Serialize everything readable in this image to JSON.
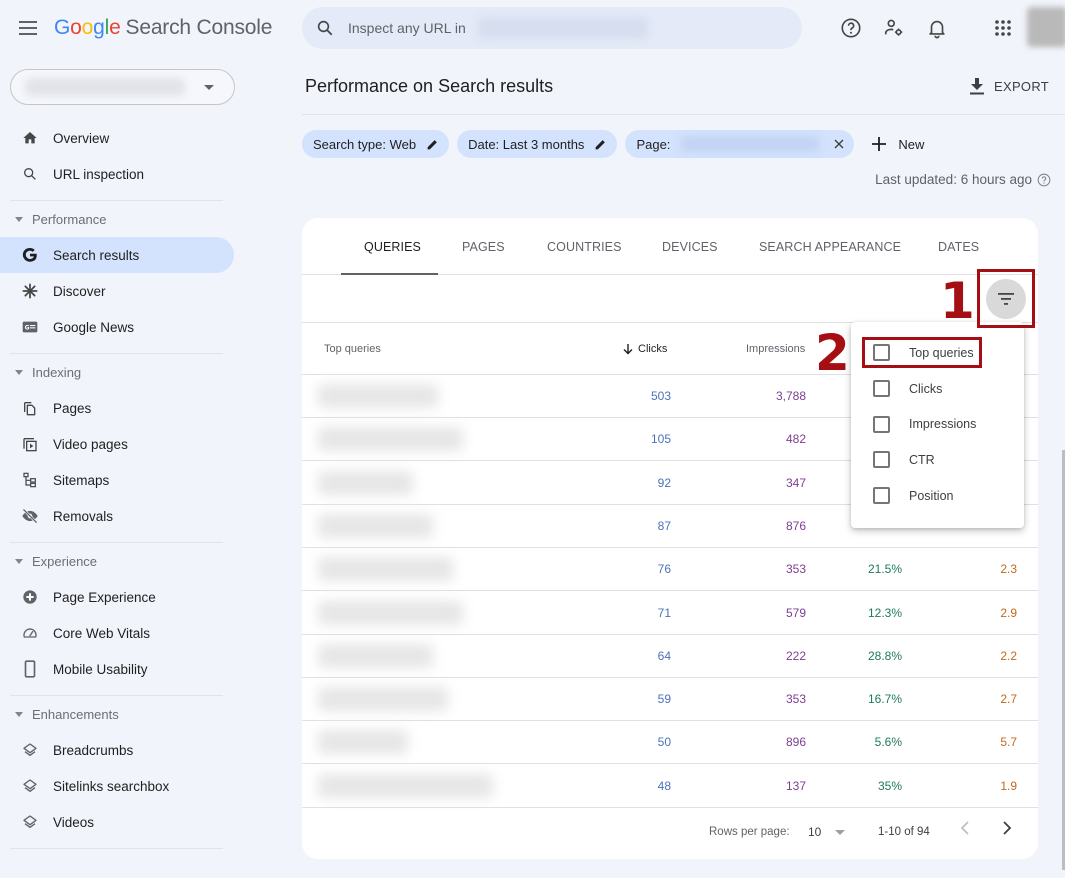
{
  "app": {
    "logo_google": [
      "G",
      "o",
      "o",
      "g",
      "l",
      "e"
    ],
    "logo_product": "Search Console",
    "search_placeholder": "Inspect any URL in",
    "top_icons": [
      "help-icon",
      "manage-users-icon",
      "notifications-icon",
      "apps-grid-icon"
    ]
  },
  "sidebar": {
    "property_selector": "",
    "items": [
      {
        "label": "Overview",
        "icon": "home-icon"
      },
      {
        "label": "URL inspection",
        "icon": "search-icon"
      }
    ],
    "sections": [
      {
        "title": "Performance",
        "items": [
          {
            "label": "Search results",
            "icon": "google-g-icon",
            "active": true
          },
          {
            "label": "Discover",
            "icon": "asterisk-icon"
          },
          {
            "label": "Google News",
            "icon": "news-icon"
          }
        ]
      },
      {
        "title": "Indexing",
        "items": [
          {
            "label": "Pages",
            "icon": "pages-icon"
          },
          {
            "label": "Video pages",
            "icon": "video-pages-icon"
          },
          {
            "label": "Sitemaps",
            "icon": "sitemap-icon"
          },
          {
            "label": "Removals",
            "icon": "eye-off-icon"
          }
        ]
      },
      {
        "title": "Experience",
        "items": [
          {
            "label": "Page Experience",
            "icon": "plus-circle-icon"
          },
          {
            "label": "Core Web Vitals",
            "icon": "gauge-icon"
          },
          {
            "label": "Mobile Usability",
            "icon": "phone-icon"
          }
        ]
      },
      {
        "title": "Enhancements",
        "items": [
          {
            "label": "Breadcrumbs",
            "icon": "layers-icon"
          },
          {
            "label": "Sitelinks searchbox",
            "icon": "layers-icon"
          },
          {
            "label": "Videos",
            "icon": "layers-icon"
          }
        ]
      }
    ]
  },
  "header": {
    "title": "Performance on Search results",
    "export_label": "EXPORT",
    "filters": [
      {
        "label": "Search type: Web",
        "action": "edit"
      },
      {
        "label": "Date: Last 3 months",
        "action": "edit"
      },
      {
        "label": "Page:",
        "action": "remove"
      }
    ],
    "new_filter_label": "New",
    "last_updated": "Last updated: 6 hours ago"
  },
  "report": {
    "tabs": [
      {
        "label": "QUERIES",
        "active": true
      },
      {
        "label": "PAGES"
      },
      {
        "label": "COUNTRIES"
      },
      {
        "label": "DEVICES"
      },
      {
        "label": "SEARCH APPEARANCE"
      },
      {
        "label": "DATES"
      }
    ],
    "columns": {
      "query": "Top queries",
      "clicks": "Clicks",
      "impressions": "Impressions",
      "sorted_by": "Clicks",
      "sort_direction": "descending"
    },
    "rows": [
      {
        "clicks": "503",
        "impressions": "3,788",
        "ctr": "",
        "position": ""
      },
      {
        "clicks": "105",
        "impressions": "482",
        "ctr": "",
        "position": ""
      },
      {
        "clicks": "92",
        "impressions": "347",
        "ctr": "",
        "position": ""
      },
      {
        "clicks": "87",
        "impressions": "876",
        "ctr": "",
        "position": ""
      },
      {
        "clicks": "76",
        "impressions": "353",
        "ctr": "21.5%",
        "position": "2.3"
      },
      {
        "clicks": "71",
        "impressions": "579",
        "ctr": "12.3%",
        "position": "2.9"
      },
      {
        "clicks": "64",
        "impressions": "222",
        "ctr": "28.8%",
        "position": "2.2"
      },
      {
        "clicks": "59",
        "impressions": "353",
        "ctr": "16.7%",
        "position": "2.7"
      },
      {
        "clicks": "50",
        "impressions": "896",
        "ctr": "5.6%",
        "position": "5.7"
      },
      {
        "clicks": "48",
        "impressions": "137",
        "ctr": "35%",
        "position": "1.9"
      }
    ],
    "pagination": {
      "rows_per_page_label": "Rows per page:",
      "rows_per_page": "10",
      "range": "1-10 of 94"
    }
  },
  "column_menu": {
    "options": [
      {
        "label": "Top queries",
        "checked": false
      },
      {
        "label": "Clicks",
        "checked": false
      },
      {
        "label": "Impressions",
        "checked": false
      },
      {
        "label": "CTR",
        "checked": false
      },
      {
        "label": "Position",
        "checked": false
      }
    ]
  },
  "annotations": {
    "step1": "1",
    "step2": "2",
    "color": "#a50f14"
  },
  "colors": {
    "clicks": "#4b73b8",
    "impressions": "#7d3e91",
    "ctr": "#1f7a5c",
    "position": "#c26a1f",
    "active_nav": "#d3e3fd",
    "chip": "#d3e3fd"
  }
}
